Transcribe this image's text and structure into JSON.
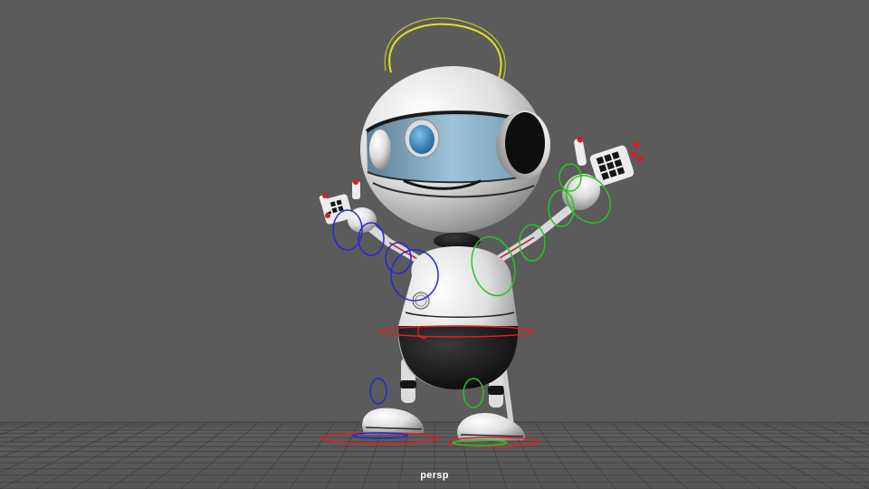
{
  "viewport": {
    "camera_name": "persp",
    "background_color": "#5b5b5b",
    "grid_color": "#3a3a3a"
  },
  "character": {
    "body_color": "#e8e8e8",
    "dark_color": "#151515",
    "visor_color": "#8fb4cc",
    "eye_color": "#3d8fd0"
  },
  "rig_controls": [
    {
      "name": "antenna-control",
      "color": "#e0e020"
    },
    {
      "name": "cog-control",
      "color": "#e02020"
    },
    {
      "name": "left-arm-ik-control",
      "color": "#2020d0"
    },
    {
      "name": "right-arm-ik-control",
      "color": "#20c020"
    },
    {
      "name": "left-foot-control",
      "color": "#2020d0"
    },
    {
      "name": "right-foot-control",
      "color": "#20c020"
    }
  ]
}
